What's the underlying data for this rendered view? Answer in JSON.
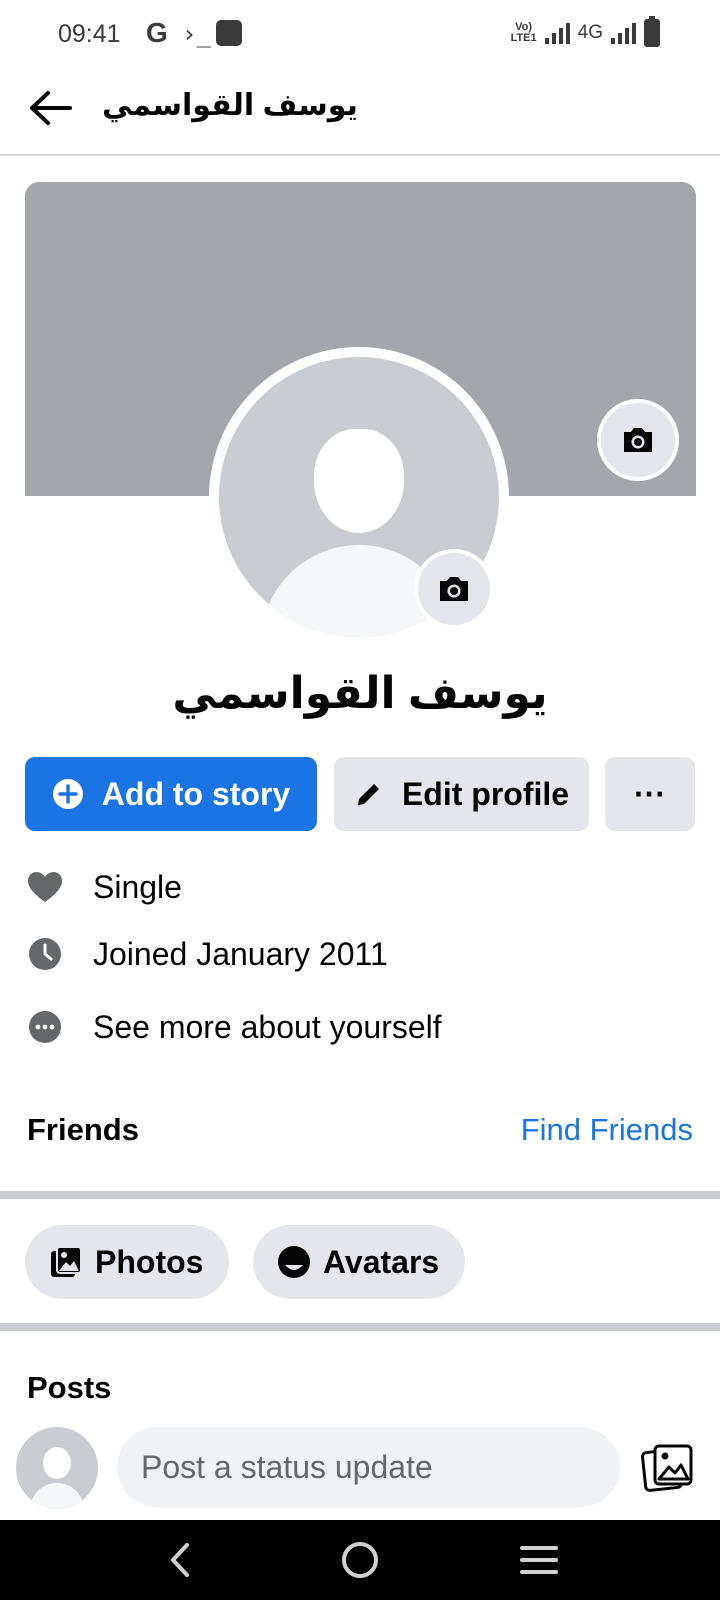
{
  "status_bar": {
    "time": "09:41",
    "google": "G",
    "terminal": "›_",
    "volte": "Vo)\nLTE1",
    "network": "4G"
  },
  "header": {
    "back_icon": "arrow-left-icon",
    "title": "يوسف القواسمي"
  },
  "profile": {
    "name": "يوسف القواسمي",
    "cover_color": "#a3a6ab"
  },
  "actions": {
    "add_to_story": "Add to story",
    "edit_profile": "Edit profile",
    "more": "···"
  },
  "details": [
    {
      "icon": "heart-icon",
      "text": "Single"
    },
    {
      "icon": "clock-icon",
      "text": "Joined January 2011"
    },
    {
      "icon": "more-circle-icon",
      "text": "See more about yourself"
    }
  ],
  "friends": {
    "title": "Friends",
    "find_link": "Find Friends"
  },
  "tabs": {
    "photos": "Photos",
    "avatars": "Avatars"
  },
  "posts": {
    "title": "Posts",
    "status_placeholder": "Post a status update"
  },
  "colors": {
    "accent": "#1b74e4",
    "button_gray": "#e4e6eb",
    "separator": "#c9ccd1"
  }
}
